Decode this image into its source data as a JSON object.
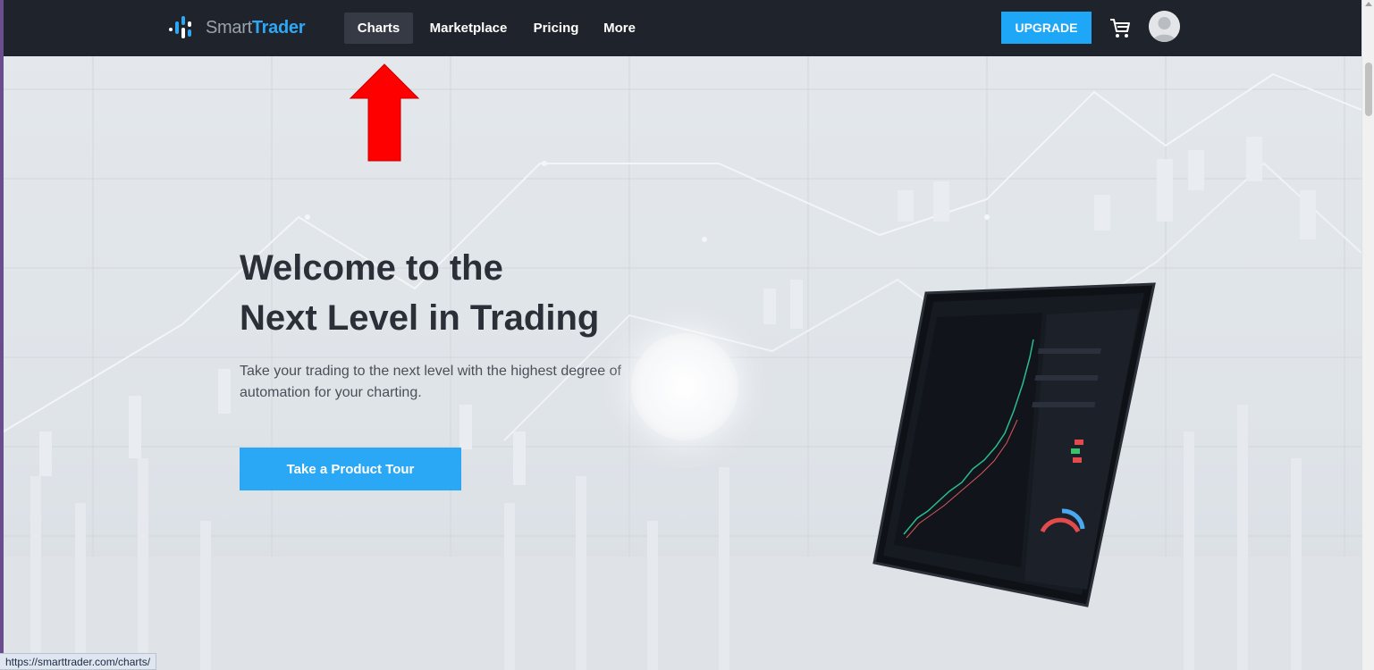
{
  "brand": {
    "name_light": "Smart",
    "name_bold": "Trader"
  },
  "nav": {
    "items": [
      {
        "label": "Charts",
        "active": true
      },
      {
        "label": "Marketplace",
        "active": false
      },
      {
        "label": "Pricing",
        "active": false
      },
      {
        "label": "More",
        "active": false
      }
    ],
    "upgrade_label": "UPGRADE"
  },
  "hero": {
    "title_line1": "Welcome to the",
    "title_line2": "Next Level in Trading",
    "subtitle": "Take your trading to the next level with the highest degree of automation for your charting.",
    "cta_label": "Take a Product Tour"
  },
  "status_url": "https://smarttrader.com/charts/",
  "icons": [
    "logo-mark",
    "cart-icon",
    "avatar",
    "red-arrow",
    "tablet-illustration"
  ],
  "colors": {
    "navbar": "#1f232b",
    "accent": "#1ea7f7",
    "cta": "#2aa8f5",
    "arrow": "#ff0000",
    "title": "#2b2f38"
  }
}
